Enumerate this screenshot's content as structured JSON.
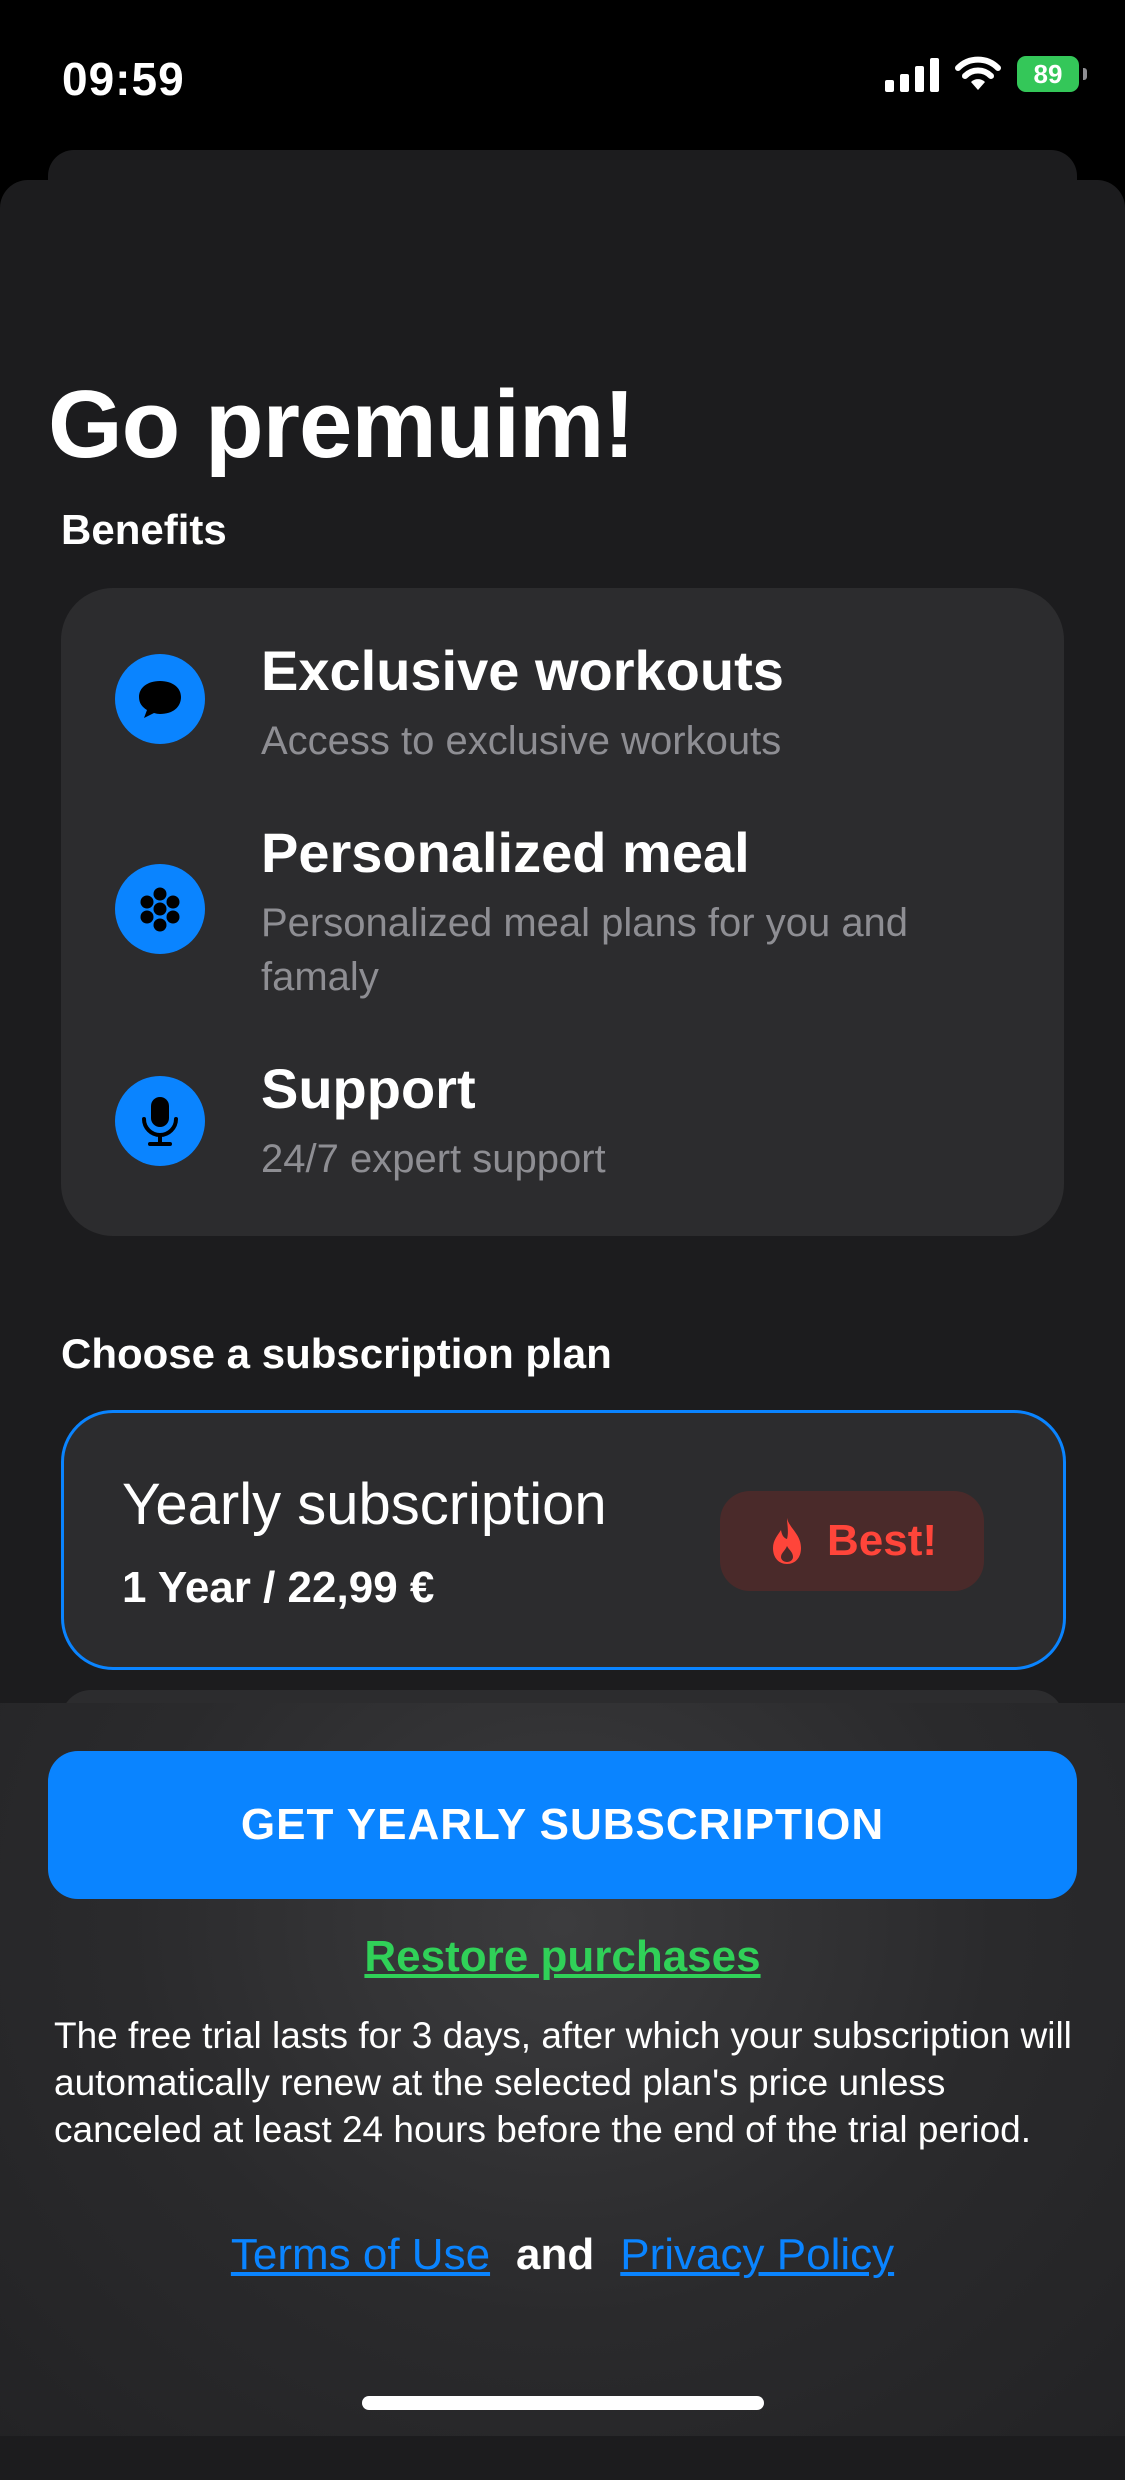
{
  "status_bar": {
    "time": "09:59",
    "battery": "89",
    "icons": [
      "cellular-signal-icon",
      "wifi-icon",
      "battery-charging-icon"
    ]
  },
  "page": {
    "title": "Go premuim!",
    "benefits_label": "Benefits",
    "plans_label": "Choose a subscription plan"
  },
  "benefits": [
    {
      "icon": "chat-bubble-icon",
      "title": "Exclusive workouts",
      "description": "Access to exclusive workouts"
    },
    {
      "icon": "dots-grid-icon",
      "title": "Personalized meal",
      "description": "Personalized meal plans for you and famaly"
    },
    {
      "icon": "microphone-icon",
      "title": "Support",
      "description": "24/7 expert support"
    }
  ],
  "plan": {
    "title": "Yearly subscription",
    "price": "1 Year / 22,99 €",
    "badge_icon": "flame-icon",
    "badge_label": "Best!",
    "selected": true
  },
  "footer": {
    "cta_label": "GET YEARLY SUBSCRIPTION",
    "restore_label": "Restore purchases",
    "disclaimer": "The free trial lasts for 3 days, after which your subscription will automatically renew at the selected plan's price unless canceled at least 24 hours before the end of the trial period.",
    "terms_label": "Terms of Use",
    "and_label": "and",
    "privacy_label": "Privacy Policy"
  },
  "colors": {
    "accent": "#0a84ff",
    "restore": "#30d158",
    "badge_text": "#ff453a",
    "battery": "#34c759"
  }
}
